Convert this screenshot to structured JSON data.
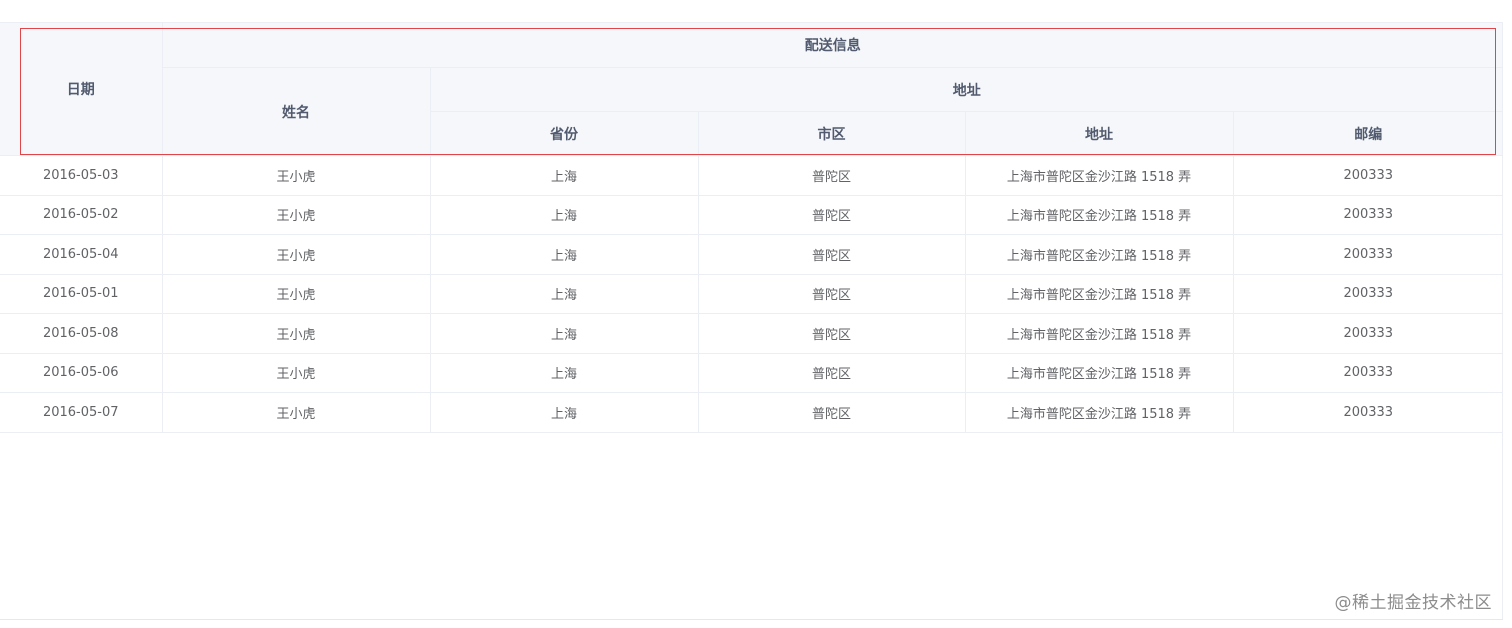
{
  "table": {
    "header": {
      "date": "日期",
      "group_delivery": "配送信息",
      "name": "姓名",
      "group_address": "地址",
      "province": "省份",
      "city": "市区",
      "address": "地址",
      "zip": "邮编"
    },
    "rows": [
      {
        "date": "2016-05-03",
        "name": "王小虎",
        "province": "上海",
        "city": "普陀区",
        "address": "上海市普陀区金沙江路 1518 弄",
        "zip": "200333"
      },
      {
        "date": "2016-05-02",
        "name": "王小虎",
        "province": "上海",
        "city": "普陀区",
        "address": "上海市普陀区金沙江路 1518 弄",
        "zip": "200333"
      },
      {
        "date": "2016-05-04",
        "name": "王小虎",
        "province": "上海",
        "city": "普陀区",
        "address": "上海市普陀区金沙江路 1518 弄",
        "zip": "200333"
      },
      {
        "date": "2016-05-01",
        "name": "王小虎",
        "province": "上海",
        "city": "普陀区",
        "address": "上海市普陀区金沙江路 1518 弄",
        "zip": "200333"
      },
      {
        "date": "2016-05-08",
        "name": "王小虎",
        "province": "上海",
        "city": "普陀区",
        "address": "上海市普陀区金沙江路 1518 弄",
        "zip": "200333"
      },
      {
        "date": "2016-05-06",
        "name": "王小虎",
        "province": "上海",
        "city": "普陀区",
        "address": "上海市普陀区金沙江路 1518 弄",
        "zip": "200333"
      },
      {
        "date": "2016-05-07",
        "name": "王小虎",
        "province": "上海",
        "city": "普陀区",
        "address": "上海市普陀区金沙江路 1518 弄",
        "zip": "200333"
      }
    ]
  },
  "highlight_color": "#e0454a",
  "watermark": "@稀土掘金技术社区"
}
